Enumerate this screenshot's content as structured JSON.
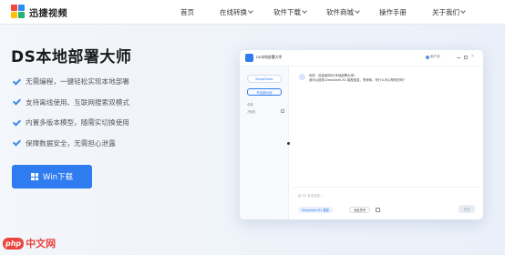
{
  "brand": {
    "name": "迅捷视频"
  },
  "nav": {
    "items": [
      {
        "label": "首页",
        "has_dropdown": false
      },
      {
        "label": "在线转换",
        "has_dropdown": true
      },
      {
        "label": "软件下载",
        "has_dropdown": true
      },
      {
        "label": "软件商城",
        "has_dropdown": true
      },
      {
        "label": "操作手册",
        "has_dropdown": false
      },
      {
        "label": "关于我们",
        "has_dropdown": true
      }
    ]
  },
  "hero": {
    "title": "DS本地部署大师",
    "features": [
      "无需编程，一键轻松实现本地部署",
      "支持离线使用、互联网搜索双模式",
      "内置多版本模型，随需实切换使用",
      "保障数据安全，无需担心泄露"
    ],
    "download_button": "Win下载",
    "accent_color": "#2f7cf1"
  },
  "app_preview": {
    "window_title": "DS本地部署大师",
    "user_label": "用户名",
    "model_pill": "DeepSeek",
    "new_chat": "开启新对话",
    "sidebar_items": [
      "今天",
      "7天内"
    ],
    "message_lines": [
      "你好，欢迎使用DS本地部署大师！",
      "我可以使用 DeepSeek-R1 模型回答，思考和，有什么可以帮你的吗？"
    ],
    "input_placeholder": "给 DS 发送消息...",
    "model_chip": "DeepSeek-R1 模型",
    "deep_think_chip": "深度思考",
    "send_label": "发送"
  },
  "watermark": {
    "badge": "php",
    "text": "中文网"
  }
}
